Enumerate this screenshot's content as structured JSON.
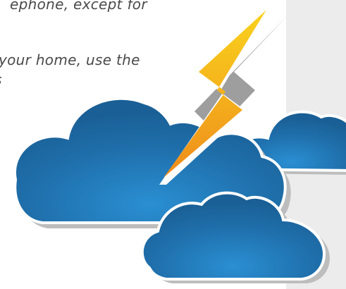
{
  "document": {
    "text_lines": [
      "ephone, except for",
      "your home, use the",
      "s"
    ]
  },
  "illustration": {
    "icon": "storm-clouds-lightning-icon",
    "colors": {
      "cloud_blue": "#1e6aa6",
      "cloud_highlight": "#2a86c8",
      "cloud_outline": "#ffffff",
      "shadow_gray": "#bdbdbd",
      "bolt_yellow": "#f7c21b",
      "bolt_orange": "#f0941c",
      "panel_gray": "#ececec"
    }
  }
}
